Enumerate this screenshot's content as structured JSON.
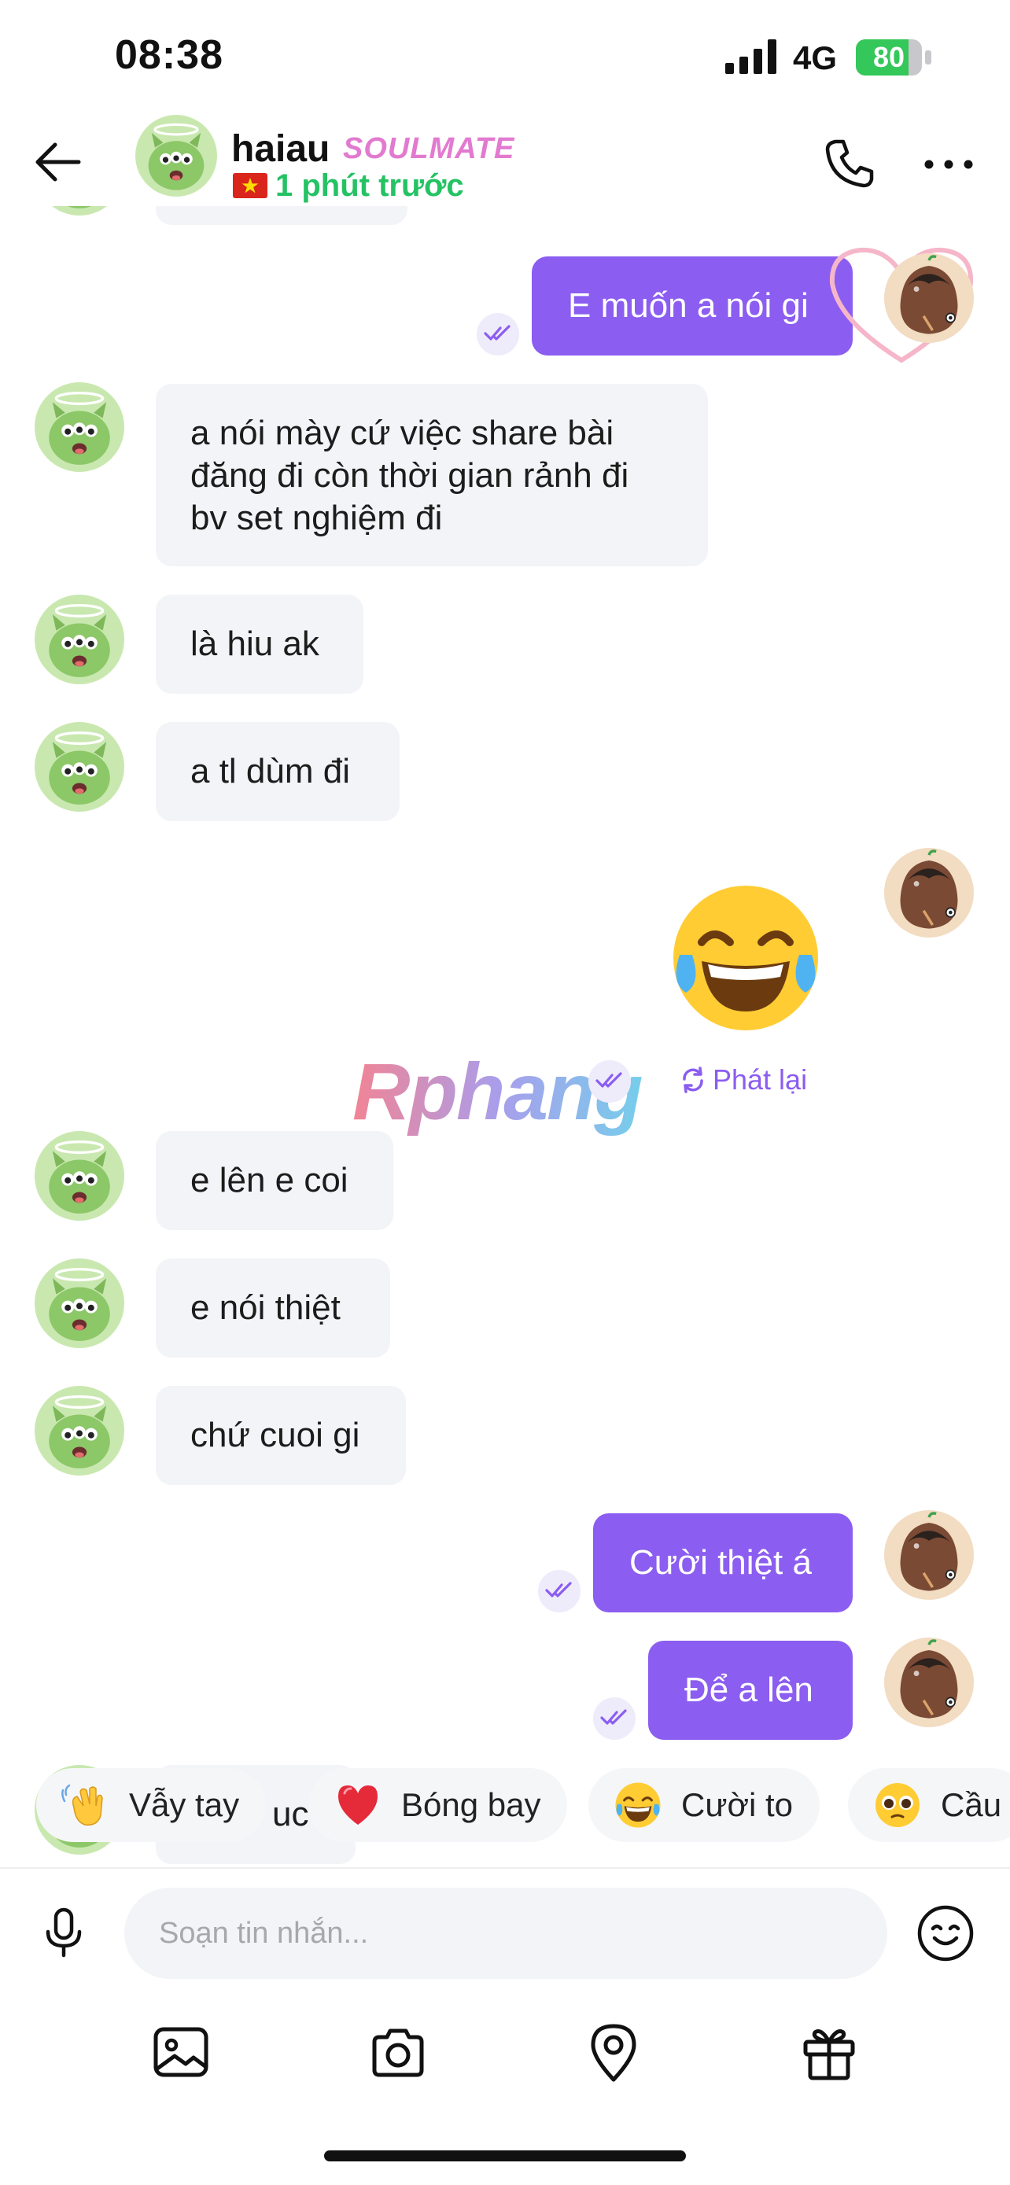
{
  "status_bar": {
    "time": "08:38",
    "network": "4G",
    "battery": "80",
    "battery_level": 0.8
  },
  "header": {
    "contact_name": "haiau",
    "badge": "SOULMATE",
    "last_seen": "1 phút trước",
    "icons": [
      "back-arrow-icon",
      "phone-icon",
      "more-icon",
      "vietnam-flag-icon"
    ]
  },
  "messages": [
    {
      "dir": "out",
      "text": "E muốn a nói gi"
    },
    {
      "dir": "in",
      "lines": [
        "a nói mày cứ việc share bài",
        "đăng đi còn thời gian rảnh đi",
        "bv set nghiệm đi"
      ]
    },
    {
      "dir": "in",
      "text": "là hiu ak"
    },
    {
      "dir": "in",
      "text": "a tl dùm đi"
    },
    {
      "dir": "out",
      "emoji": "😂"
    },
    {
      "dir": "in",
      "text": "e lên e coi"
    },
    {
      "dir": "in",
      "text": "e nói thiệt"
    },
    {
      "dir": "in",
      "text": "chứ cuoi gi"
    },
    {
      "dir": "out",
      "text": "Cười thiệt á"
    },
    {
      "dir": "out",
      "text": "Để a lên"
    }
  ],
  "partial_message_text": "uc",
  "replay_label": "Phát lại",
  "watermark": "Rphang",
  "quick_reactions": [
    {
      "emoji": "👋",
      "label": "Vẫy tay"
    },
    {
      "emoji": "❤️",
      "label": "Bóng bay"
    },
    {
      "emoji": "😂",
      "label": "Cười to"
    },
    {
      "emoji": "🥺",
      "label": "Cầu"
    }
  ],
  "composer": {
    "placeholder": "Soạn tin nhắn...",
    "toolbar": [
      "gallery-icon",
      "camera-icon",
      "location-icon",
      "gift-icon"
    ]
  },
  "colors": {
    "accent": "#8b5df0",
    "online": "#25c264",
    "incoming_bubble": "#f3f4f7"
  }
}
